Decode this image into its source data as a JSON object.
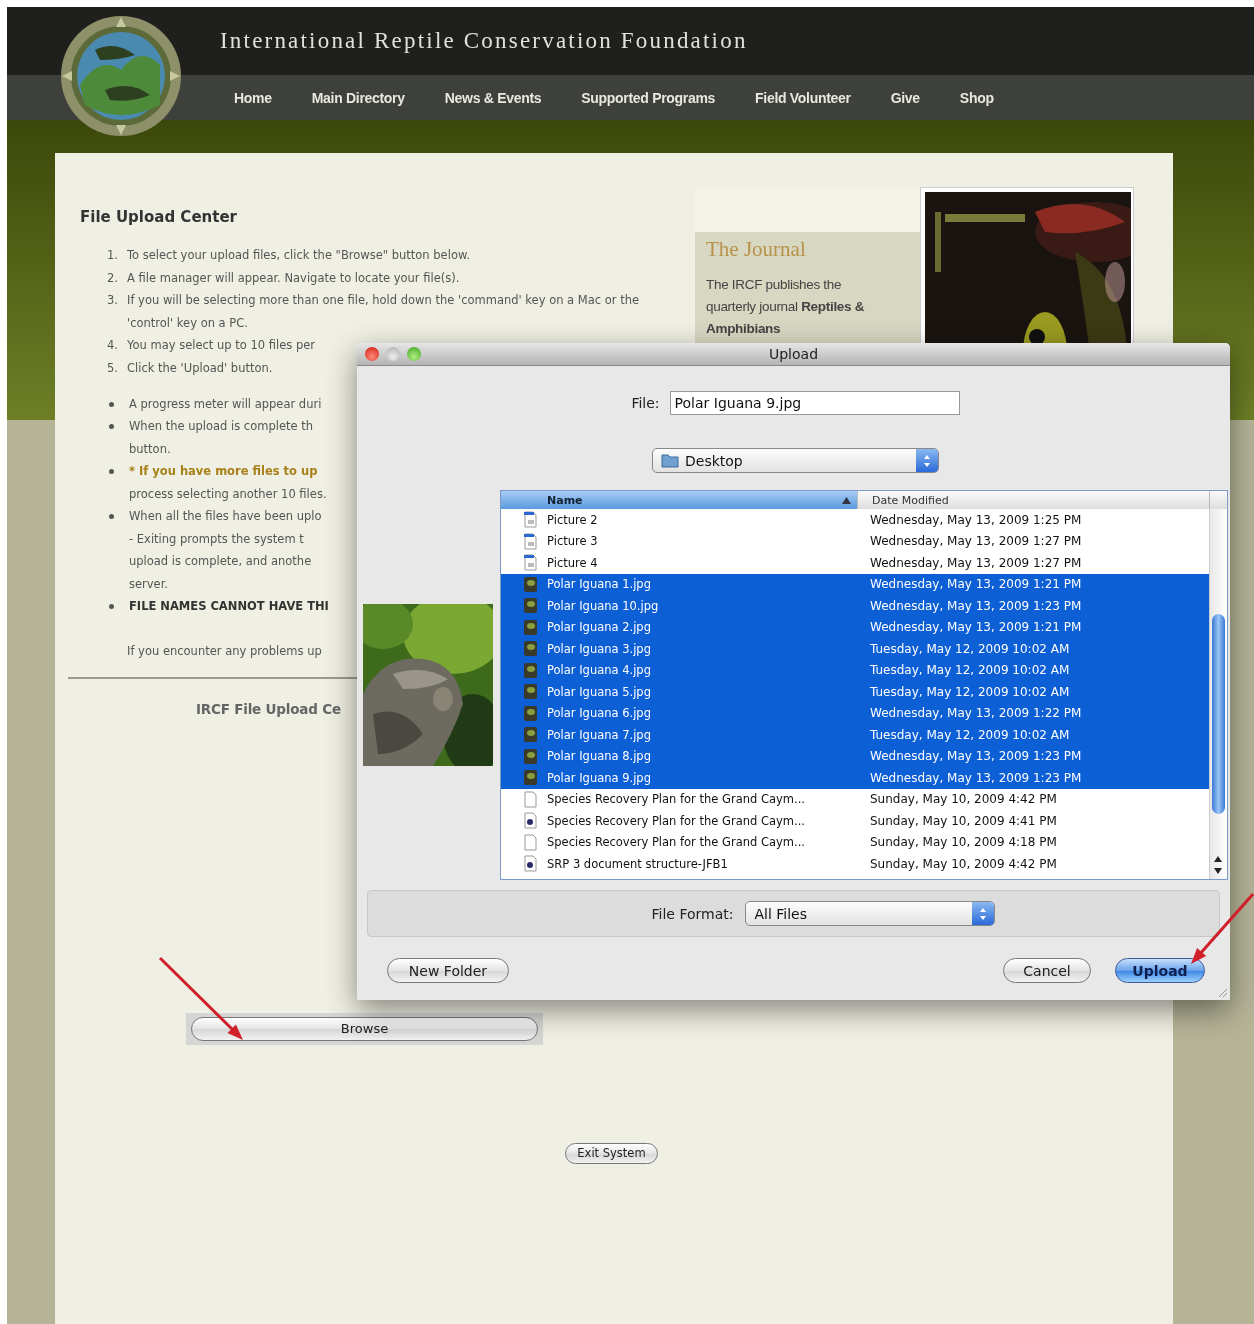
{
  "site": {
    "title": "International Reptile Conservation Foundation",
    "nav": [
      "Home",
      "Main Directory",
      "News & Events",
      "Supported Programs",
      "Field Volunteer",
      "Give",
      "Shop"
    ]
  },
  "page": {
    "heading": "File Upload Center",
    "steps": [
      {
        "number": "1.",
        "text": "To select your upload files, click the \"Browse\" button below."
      },
      {
        "number": "2.",
        "text": "A file manager will appear. Navigate to locate your file(s)."
      },
      {
        "number": "3.",
        "text": "If you will be selecting more than one file, hold down the 'command' key on a Mac or the 'control' key on a PC."
      },
      {
        "number": "4.",
        "text": "You may select up to 10 files per"
      },
      {
        "number": "5.",
        "text": "Click the 'Upload' button."
      }
    ],
    "notes": [
      {
        "lines": [
          {
            "kind": "plain",
            "text": "A progress meter will appear duri"
          }
        ]
      },
      {
        "lines": [
          {
            "kind": "plain",
            "text": "When the upload is complete th"
          },
          {
            "kind": "plain",
            "text": "button."
          }
        ]
      },
      {
        "lines": [
          {
            "kind": "warning",
            "text": "* If you have more files to up"
          },
          {
            "kind": "plain",
            "text": "process selecting another 10 files."
          }
        ]
      },
      {
        "lines": [
          {
            "kind": "plain",
            "text": "When all the files have been uplo"
          },
          {
            "kind": "plain",
            "text": "- Exiting prompts the system t"
          },
          {
            "kind": "plain",
            "text": "upload is complete, and anothe"
          },
          {
            "kind": "plain",
            "text": "server."
          }
        ]
      },
      {
        "lines": [
          {
            "kind": "caps",
            "text": "FILE NAMES CANNOT HAVE THI"
          }
        ]
      }
    ],
    "help": "If you encounter any problems up",
    "upload_title": "IRCF File Upload Ce",
    "browse_button": "Browse",
    "exit_button": "Exit System"
  },
  "journal": {
    "title": "The Journal",
    "text": "The IRCF publishes the quarterly journal **Reptiles & Amphibians**"
  },
  "dialog": {
    "title": "Upload",
    "file_label": "File:",
    "file_value": "Polar Iguana 9.jpg",
    "location": "Desktop",
    "columns": [
      {
        "label": "Name",
        "sorted": true
      },
      {
        "label": "Date Modified",
        "sorted": false
      }
    ],
    "rows": [
      {
        "kind": "screenshot",
        "name": "Picture 2",
        "date": "Wednesday, May 13, 2009 1:25 PM",
        "selected": false
      },
      {
        "kind": "screenshot",
        "name": "Picture 3",
        "date": "Wednesday, May 13, 2009 1:27 PM",
        "selected": false
      },
      {
        "kind": "screenshot",
        "name": "Picture 4",
        "date": "Wednesday, May 13, 2009 1:27 PM",
        "selected": false
      },
      {
        "name": "Polar Iguana 1.jpg",
        "date": "Wednesday, May 13, 2009 1:21 PM",
        "selected": true
      },
      {
        "name": "Polar Iguana 10.jpg",
        "date": "Wednesday, May 13, 2009 1:23 PM",
        "selected": true
      },
      {
        "name": "Polar Iguana 2.jpg",
        "date": "Wednesday, May 13, 2009 1:21 PM",
        "selected": true
      },
      {
        "name": "Polar Iguana 3.jpg",
        "date": "Tuesday, May 12, 2009 10:02 AM",
        "selected": true
      },
      {
        "name": "Polar Iguana 4.jpg",
        "date": "Tuesday, May 12, 2009 10:02 AM",
        "selected": true
      },
      {
        "name": "Polar Iguana 5.jpg",
        "date": "Tuesday, May 12, 2009 10:02 AM",
        "selected": true
      },
      {
        "name": "Polar Iguana 6.jpg",
        "date": "Wednesday, May 13, 2009 1:22 PM",
        "selected": true
      },
      {
        "name": "Polar Iguana 7.jpg",
        "date": "Tuesday, May 12, 2009 10:02 AM",
        "selected": true
      },
      {
        "name": "Polar Iguana 8.jpg",
        "date": "Wednesday, May 13, 2009 1:23 PM",
        "selected": true
      },
      {
        "name": "Polar Iguana 9.jpg",
        "date": "Wednesday, May 13, 2009 1:23 PM",
        "selected": true
      },
      {
        "kind": "blank",
        "name": "Species Recovery Plan for the Grand Caym...",
        "date": "Sunday, May 10, 2009 4:42 PM",
        "selected": false
      },
      {
        "kind": "document",
        "name": "Species Recovery Plan for the Grand Caym...",
        "date": "Sunday, May 10, 2009 4:41 PM",
        "selected": false
      },
      {
        "kind": "blank",
        "name": "Species Recovery Plan for the Grand Caym...",
        "date": "Sunday, May 10, 2009 4:18 PM",
        "selected": false
      },
      {
        "kind": "document",
        "name": "SRP 3 document structure-JFB1",
        "date": "Sunday, May 10, 2009 4:42 PM",
        "selected": false
      }
    ],
    "format_label": "File Format:",
    "format_value": "All Files",
    "buttons": [
      {
        "label": "New Folder",
        "default": false
      },
      {
        "label": "Cancel",
        "default": false
      },
      {
        "label": "Upload",
        "default": true
      }
    ]
  }
}
